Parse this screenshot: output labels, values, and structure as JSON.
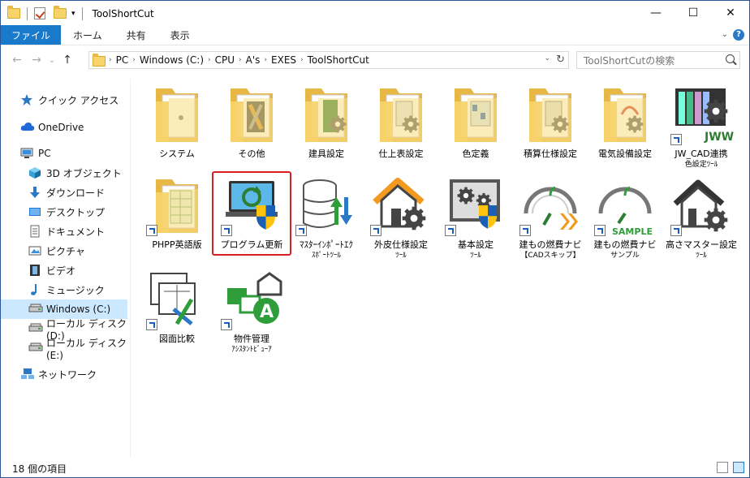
{
  "window": {
    "title": "ToolShortCut",
    "minimize": "—",
    "maximize": "☐",
    "close": "✕"
  },
  "ribbon": {
    "tabs": [
      "ファイル",
      "ホーム",
      "共有",
      "表示"
    ],
    "help": "?"
  },
  "nav": {
    "back": "←",
    "forward": "→",
    "recent": "⌄",
    "up": "↑"
  },
  "address": {
    "crumbs": [
      "PC",
      "Windows (C:)",
      "CPU",
      "A's",
      "EXES",
      "ToolShortCut"
    ],
    "separator": "›",
    "dropdown": "⌄",
    "refresh": "↻"
  },
  "search": {
    "placeholder": "ToolShortCutの検索"
  },
  "sidebar": {
    "items": [
      {
        "label": "クイック アクセス",
        "icon": "star-icon",
        "color": "#2a78c6"
      },
      {
        "label": "OneDrive",
        "icon": "cloud-icon",
        "color": "#1e6ad6"
      },
      {
        "label": "PC",
        "icon": "computer-icon",
        "color": "#444444"
      },
      {
        "label": "3D オブジェクト",
        "icon": "cube-icon",
        "color": "#3aa0d8"
      },
      {
        "label": "ダウンロード",
        "icon": "download-icon",
        "color": "#2a78c6"
      },
      {
        "label": "デスクトップ",
        "icon": "desktop-icon",
        "color": "#1e7ad6"
      },
      {
        "label": "ドキュメント",
        "icon": "document-icon",
        "color": "#666666"
      },
      {
        "label": "ピクチャ",
        "icon": "picture-icon",
        "color": "#555555"
      },
      {
        "label": "ビデオ",
        "icon": "video-icon",
        "color": "#333333"
      },
      {
        "label": "ミュージック",
        "icon": "music-icon",
        "color": "#2a78c6"
      },
      {
        "label": "Windows (C:)",
        "icon": "drive-icon",
        "color": "#555555"
      },
      {
        "label": "ローカル ディスク (D:)",
        "icon": "drive-icon",
        "color": "#555555"
      },
      {
        "label": "ローカル ディスク (E:)",
        "icon": "drive-icon",
        "color": "#555555"
      },
      {
        "label": "ネットワーク",
        "icon": "network-icon",
        "color": "#2a78c6"
      }
    ],
    "selected_index": 10
  },
  "items": [
    {
      "label": "システム",
      "sub": "",
      "kind": "folder",
      "icon": "folder-system-icon"
    },
    {
      "label": "その他",
      "sub": "",
      "kind": "folder",
      "icon": "folder-tools-icon"
    },
    {
      "label": "建具設定",
      "sub": "",
      "kind": "folder",
      "icon": "folder-door-icon"
    },
    {
      "label": "仕上表設定",
      "sub": "",
      "kind": "folder",
      "icon": "folder-finish-icon"
    },
    {
      "label": "色定義",
      "sub": "",
      "kind": "folder",
      "icon": "folder-color-icon"
    },
    {
      "label": "積算仕様設定",
      "sub": "",
      "kind": "folder",
      "icon": "folder-estimate-icon"
    },
    {
      "label": "電気設備設定",
      "sub": "",
      "kind": "folder",
      "icon": "folder-electric-icon"
    },
    {
      "label": "JW_CAD連携",
      "sub": "色設定ﾂｰﾙ",
      "kind": "shortcut",
      "icon": "jww-icon"
    },
    {
      "label": "PHPP英語版",
      "sub": "",
      "kind": "shortcut",
      "icon": "spreadsheet-icon"
    },
    {
      "label": "プログラム更新",
      "sub": "",
      "kind": "shortcut",
      "icon": "update-icon"
    },
    {
      "label": "ﾏｽﾀｰｲﾝﾎﾟｰﾄｴｸ",
      "sub": "ｽﾎﾟｰﾄﾂｰﾙ",
      "kind": "shortcut",
      "icon": "database-icon"
    },
    {
      "label": "外皮仕様設定",
      "sub": "ﾂｰﾙ",
      "kind": "shortcut",
      "icon": "house-gear-icon"
    },
    {
      "label": "基本設定",
      "sub": "ﾂｰﾙ",
      "kind": "shortcut",
      "icon": "settings-shield-icon"
    },
    {
      "label": "建もの燃費ナビ",
      "sub": "【CADスキップ】",
      "kind": "shortcut",
      "icon": "gauge-skip-icon"
    },
    {
      "label": "建もの燃費ナビ",
      "sub": "サンプル",
      "kind": "shortcut",
      "icon": "gauge-sample-icon"
    },
    {
      "label": "高さマスター設定",
      "sub": "ﾂｰﾙ",
      "kind": "shortcut",
      "icon": "house-gear2-icon"
    },
    {
      "label": "図面比較",
      "sub": "",
      "kind": "shortcut",
      "icon": "compare-icon"
    },
    {
      "label": "物件管理",
      "sub": "ｱｼｽﾀﾝﾄﾋﾞｭｰｱ",
      "kind": "shortcut",
      "icon": "assistant-icon"
    }
  ],
  "highlighted_index": 9,
  "status": {
    "count_text": "18 個の項目"
  },
  "colors": {
    "accent": "#1979ca",
    "highlight": "#d81e1e",
    "folder": "#f7d36b",
    "selection": "#cce8ff"
  }
}
